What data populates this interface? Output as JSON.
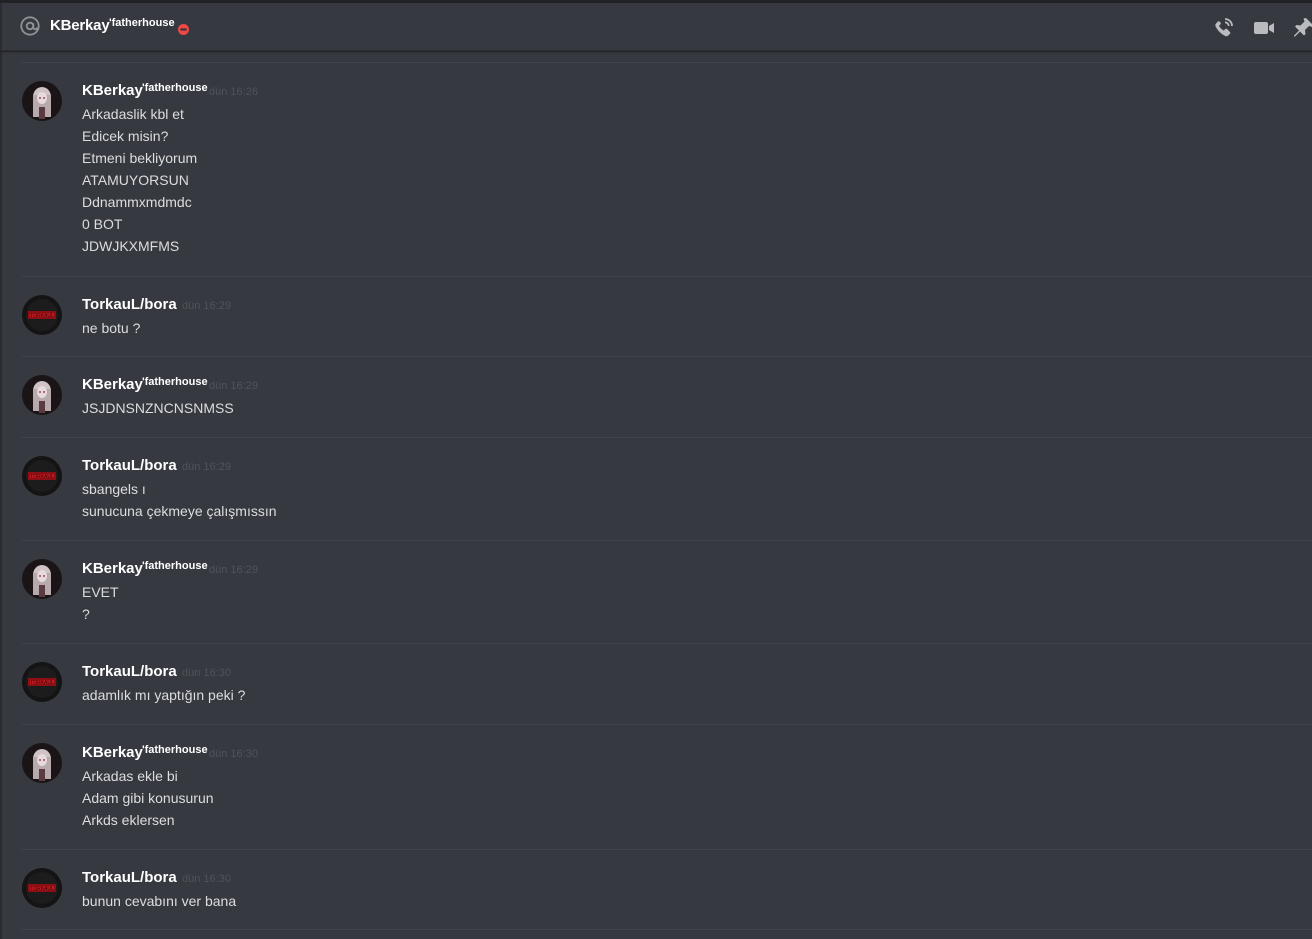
{
  "header": {
    "recipient": "KBerkay",
    "recipient_tag": "'fatherhouse",
    "status": "do-not-disturb",
    "icons": [
      "at-icon",
      "call-icon",
      "video-icon",
      "pin-icon"
    ]
  },
  "colors": {
    "background": "#36393f",
    "header_border": "#2b2d31",
    "divider": "#40434a",
    "author_text": "#ffffff",
    "message_text": "#dcddde",
    "timestamp_text": "#4f535a",
    "dnd_red": "#f04747"
  },
  "messages": [
    {
      "author": "KBerkay",
      "tag": "'fatherhouse",
      "time": "dün 16:26",
      "lines": [
        "Arkadaslik kbl et",
        "Edicek misin?",
        "Etmeni bekliyorum",
        "ATAMUYORSUN",
        "Ddnammxmdmdc",
        "0 BOT",
        "JDWJKXMFMS"
      ]
    },
    {
      "author": "TorkauL/bora",
      "tag": "",
      "time": "dün 16:29",
      "lines": [
        "ne botu ?"
      ]
    },
    {
      "author": "KBerkay",
      "tag": "'fatherhouse",
      "time": "dün 16:29",
      "lines": [
        "JSJDNSNZNCNSNMSS"
      ]
    },
    {
      "author": "TorkauL/bora",
      "tag": "",
      "time": "dün 16:29",
      "lines": [
        "sbangels ı",
        "sunucuna çekmeye çalışmıssın"
      ]
    },
    {
      "author": "KBerkay",
      "tag": "'fatherhouse",
      "time": "dün 16:29",
      "lines": [
        "EVET",
        "?"
      ]
    },
    {
      "author": "TorkauL/bora",
      "tag": "",
      "time": "dün 16:30",
      "lines": [
        "adamlık mı yaptığın peki ?"
      ]
    },
    {
      "author": "KBerkay",
      "tag": "'fatherhouse",
      "time": "dün 16:30",
      "lines": [
        "Arkadas ekle bi",
        "Adam gibi konusurun",
        "Arkds eklersen"
      ]
    },
    {
      "author": "TorkauL/bora",
      "tag": "",
      "time": "dün 16:30",
      "lines": [
        "bunun cevabını ver bana"
      ]
    }
  ]
}
